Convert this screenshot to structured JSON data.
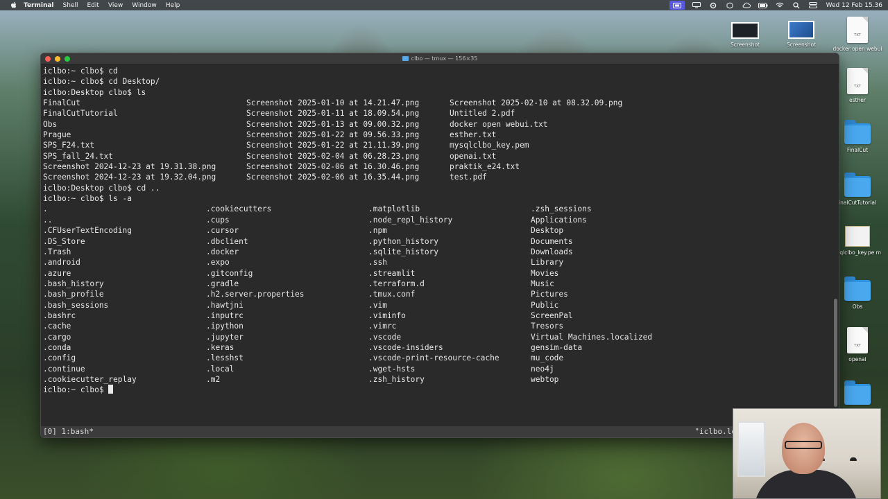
{
  "menubar": {
    "app": "Terminal",
    "items": [
      "Shell",
      "Edit",
      "View",
      "Window",
      "Help"
    ],
    "clock": "Wed 12 Feb 15.36"
  },
  "desktop": {
    "icons": [
      {
        "label": "Screenshot",
        "kind": "thumb-dark"
      },
      {
        "label": "Screenshot",
        "kind": "thumb-blue"
      },
      {
        "label": "docker open webui",
        "kind": "doc",
        "ext": "TXT"
      },
      {
        "label": "esther",
        "kind": "doc",
        "ext": "TXT"
      },
      {
        "label": "FinalCut",
        "kind": "folder"
      },
      {
        "label": "inalCutTutorial",
        "kind": "folder"
      },
      {
        "label": "ysqlclbo_key.pe m",
        "kind": "cert"
      },
      {
        "label": "Obs",
        "kind": "folder"
      },
      {
        "label": "openai",
        "kind": "doc",
        "ext": "TXT"
      },
      {
        "label": "",
        "kind": "folder"
      }
    ]
  },
  "window": {
    "title": "clbo — tmux — 156×35",
    "colors": {
      "background": "#2a2a2a",
      "text": "#e8e8e8"
    }
  },
  "terminal": {
    "lines": [
      {
        "cols": [
          "iclbo:~ clbo$ cd"
        ]
      },
      {
        "cols": [
          "iclbo:~ clbo$ cd Desktop/"
        ]
      },
      {
        "cols": [
          "iclbo:Desktop clbo$ ls"
        ]
      },
      {
        "cols": [
          "FinalCut",
          "Screenshot 2025-01-10 at 14.21.47.png",
          "Screenshot 2025-02-10 at 08.32.09.png"
        ]
      },
      {
        "cols": [
          "FinalCutTutorial",
          "Screenshot 2025-01-11 at 18.09.54.png",
          "Untitled 2.pdf"
        ]
      },
      {
        "cols": [
          "Obs",
          "Screenshot 2025-01-13 at 09.00.32.png",
          "docker open webui.txt"
        ]
      },
      {
        "cols": [
          "Prague",
          "Screenshot 2025-01-22 at 09.56.33.png",
          "esther.txt"
        ]
      },
      {
        "cols": [
          "SPS_F24.txt",
          "Screenshot 2025-01-22 at 21.11.39.png",
          "mysqlclbo_key.pem"
        ]
      },
      {
        "cols": [
          "SPS_fall_24.txt",
          "Screenshot 2025-02-04 at 06.28.23.png",
          "openai.txt"
        ]
      },
      {
        "cols": [
          "Screenshot 2024-12-23 at 19.31.38.png",
          "Screenshot 2025-02-06 at 16.30.46.png",
          "praktik_e24.txt"
        ]
      },
      {
        "cols": [
          "Screenshot 2024-12-23 at 19.32.04.png",
          "Screenshot 2025-02-06 at 16.35.44.png",
          "test.pdf"
        ]
      },
      {
        "cols": [
          "iclbo:Desktop clbo$ cd .."
        ]
      },
      {
        "cols": [
          "iclbo:~ clbo$ ls -a"
        ]
      },
      {
        "cols": [
          ".",
          ".cookiecutters",
          ".matplotlib",
          ".zsh_sessions"
        ]
      },
      {
        "cols": [
          "..",
          ".cups",
          ".node_repl_history",
          "Applications"
        ]
      },
      {
        "cols": [
          ".CFUserTextEncoding",
          ".cursor",
          ".npm",
          "Desktop"
        ]
      },
      {
        "cols": [
          ".DS_Store",
          ".dbclient",
          ".python_history",
          "Documents"
        ]
      },
      {
        "cols": [
          ".Trash",
          ".docker",
          ".sqlite_history",
          "Downloads"
        ]
      },
      {
        "cols": [
          ".android",
          ".expo",
          ".ssh",
          "Library"
        ]
      },
      {
        "cols": [
          ".azure",
          ".gitconfig",
          ".streamlit",
          "Movies"
        ]
      },
      {
        "cols": [
          ".bash_history",
          ".gradle",
          ".terraform.d",
          "Music"
        ]
      },
      {
        "cols": [
          ".bash_profile",
          ".h2.server.properties",
          ".tmux.conf",
          "Pictures"
        ]
      },
      {
        "cols": [
          ".bash_sessions",
          ".hawtjni",
          ".vim",
          "Public"
        ]
      },
      {
        "cols": [
          ".bashrc",
          ".inputrc",
          ".viminfo",
          "ScreenPal"
        ]
      },
      {
        "cols": [
          ".cache",
          ".ipython",
          ".vimrc",
          "Tresors"
        ]
      },
      {
        "cols": [
          ".cargo",
          ".jupyter",
          ".vscode",
          "Virtual Machines.localized"
        ]
      },
      {
        "cols": [
          ".conda",
          ".keras",
          ".vscode-insiders",
          "gensim-data"
        ]
      },
      {
        "cols": [
          ".config",
          ".lesshst",
          ".vscode-print-resource-cache",
          "mu_code"
        ]
      },
      {
        "cols": [
          ".continue",
          ".local",
          ".wget-hsts",
          "neo4j"
        ]
      },
      {
        "cols": [
          ".cookiecutter_replay",
          ".m2",
          ".zsh_history",
          "webtop"
        ]
      }
    ],
    "prompt": "iclbo:~ clbo$ "
  },
  "tmux": {
    "left": "[0] 1:bash*",
    "right": "\"iclbo.lo"
  }
}
